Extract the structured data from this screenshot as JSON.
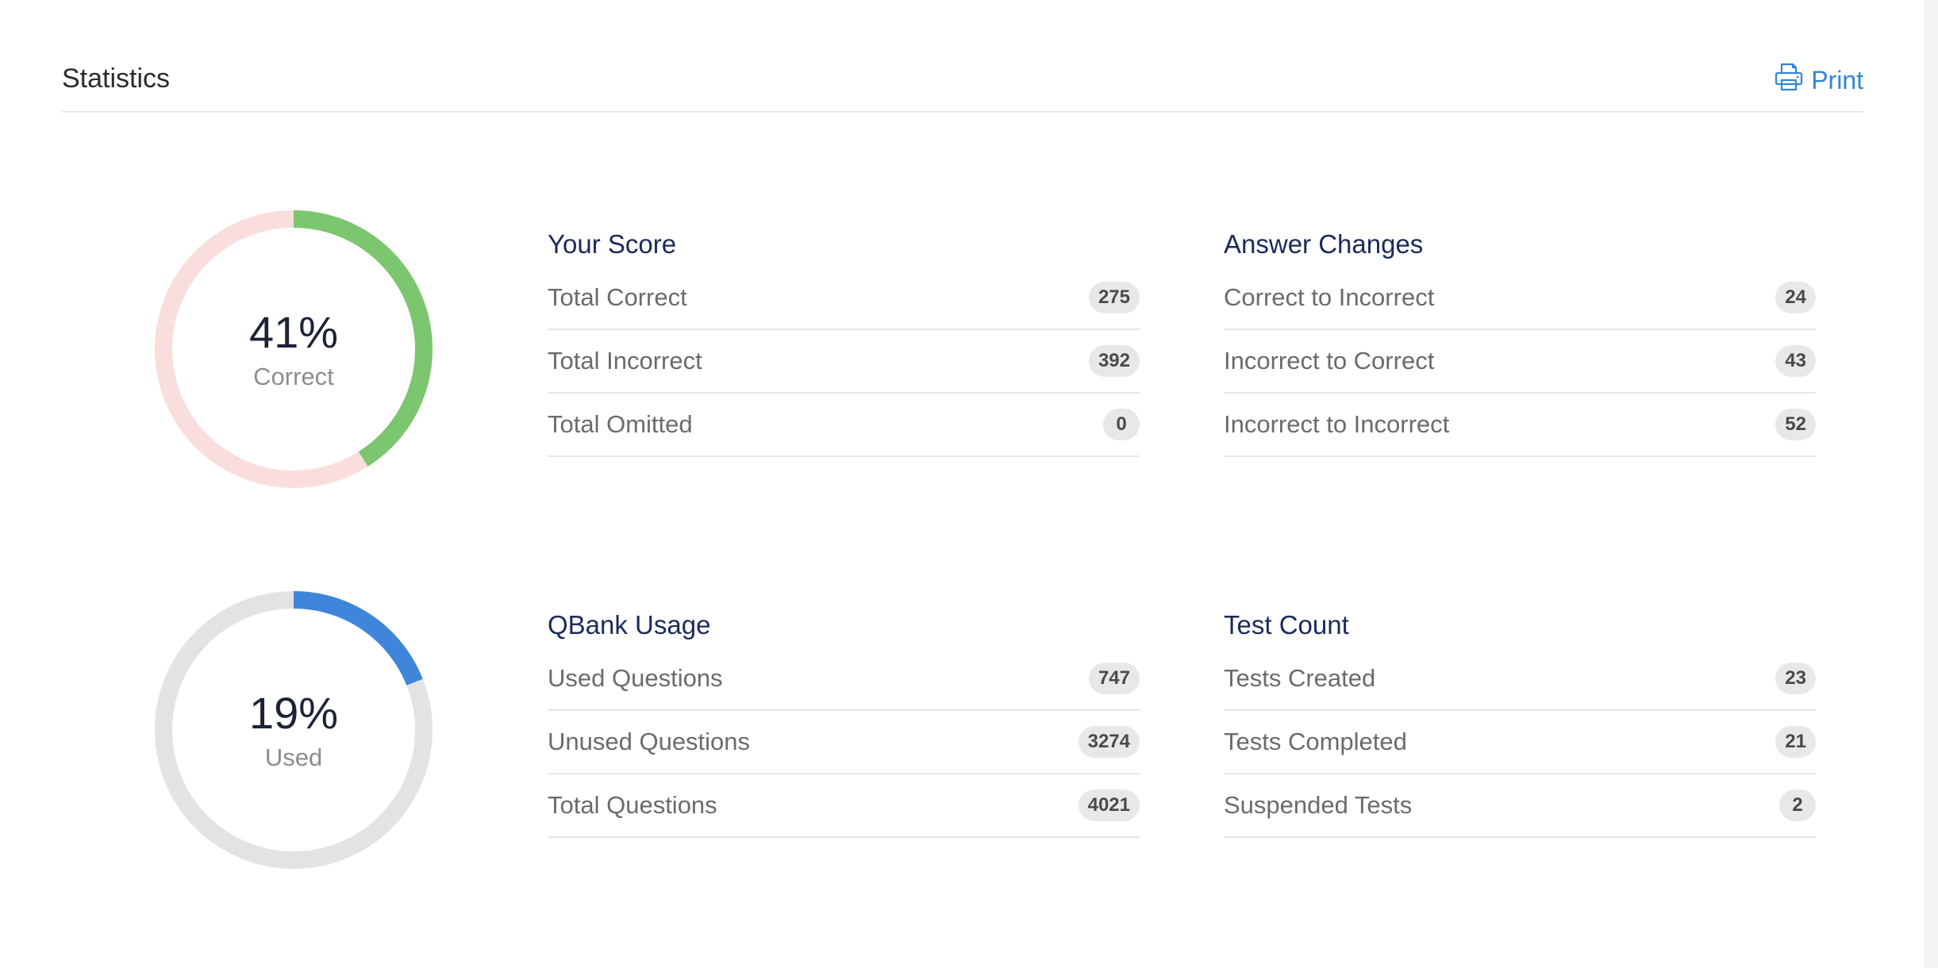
{
  "header": {
    "title": "Statistics",
    "print_label": "Print"
  },
  "score_donut": {
    "value_text": "41%",
    "label": "Correct",
    "fraction": 0.41,
    "fill_color": "#7cc670",
    "track_color": "#f9dedd"
  },
  "usage_donut": {
    "value_text": "19%",
    "label": "Used",
    "fraction": 0.19,
    "fill_color": "#3f86db",
    "track_color": "#e3e3e3"
  },
  "your_score": {
    "title": "Your Score",
    "rows": [
      {
        "label": "Total Correct",
        "value": "275"
      },
      {
        "label": "Total Incorrect",
        "value": "392"
      },
      {
        "label": "Total Omitted",
        "value": "0"
      }
    ]
  },
  "answer_changes": {
    "title": "Answer Changes",
    "rows": [
      {
        "label": "Correct to Incorrect",
        "value": "24"
      },
      {
        "label": "Incorrect to Correct",
        "value": "43"
      },
      {
        "label": "Incorrect to Incorrect",
        "value": "52"
      }
    ]
  },
  "qbank_usage": {
    "title": "QBank Usage",
    "rows": [
      {
        "label": "Used Questions",
        "value": "747"
      },
      {
        "label": "Unused Questions",
        "value": "3274"
      },
      {
        "label": "Total Questions",
        "value": "4021"
      }
    ]
  },
  "test_count": {
    "title": "Test Count",
    "rows": [
      {
        "label": "Tests Created",
        "value": "23"
      },
      {
        "label": "Tests Completed",
        "value": "21"
      },
      {
        "label": "Suspended Tests",
        "value": "2"
      }
    ]
  },
  "icons": {
    "print": "printer-icon"
  }
}
